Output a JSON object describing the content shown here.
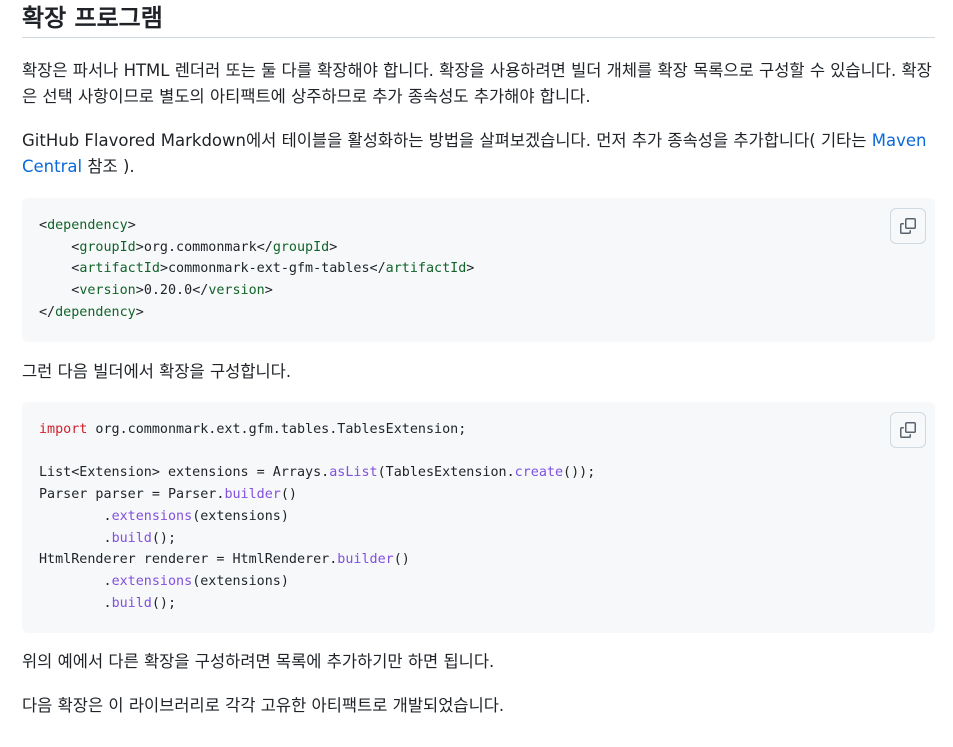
{
  "section": {
    "title": "확장 프로그램"
  },
  "paragraphs": {
    "intro": "확장은 파서나 HTML 렌더러 또는 둘 다를 확장해야 합니다. 확장을 사용하려면 빌더 개체를 확장 목록으로 구성할 수 있습니다. 확장은 선택 사항이므로 별도의 아티팩트에 상주하므로 추가 종속성도 추가해야 합니다.",
    "gfm_before_link": "GitHub Flavored Markdown에서 테이블을 활성화하는 방법을 살펴보겠습니다. 먼저 추가 종속성을 추가합니다( 기타는 ",
    "gfm_link": "Maven Central",
    "gfm_after_link": " 참조 ).",
    "configure": "그런 다음 빌더에서 확장을 구성합니다.",
    "add_more": "위의 예에서 다른 확장을 구성하려면 목록에 추가하기만 하면 됩니다.",
    "following": "다음 확장은 이 라이브러리로 각각 고유한 아티팩트로 개발되었습니다."
  },
  "code_xml": {
    "dependency_tag": "dependency",
    "group_tag": "groupId",
    "group_value": "org.commonmark",
    "artifact_tag": "artifactId",
    "artifact_value": "commonmark-ext-gfm-tables",
    "version_tag": "version",
    "version_value": "0.20.0"
  },
  "code_java": {
    "import_kw": "import",
    "import_path": " org.commonmark.ext.gfm.tables.TablesExtension;",
    "list_line_start": "List<Extension> extensions = Arrays.",
    "as_list": "asList",
    "list_line_mid": "(TablesExtension.",
    "create": "create",
    "list_line_end": "());",
    "parser_start": "Parser parser = Parser.",
    "builder": "builder",
    "parens": "()",
    "indent_dot": "        .",
    "extensions_fn": "extensions",
    "extensions_arg": "(extensions)",
    "build_fn": "build",
    "build_end": "();",
    "renderer_start": "HtmlRenderer renderer = HtmlRenderer."
  },
  "icons": {
    "copy": "copy-icon"
  },
  "colors": {
    "text": "#1f2328",
    "link": "#0969da",
    "code_bg": "#f6f8fa",
    "xml_tag": "#116329",
    "keyword": "#cf222e",
    "method": "#8250df"
  }
}
